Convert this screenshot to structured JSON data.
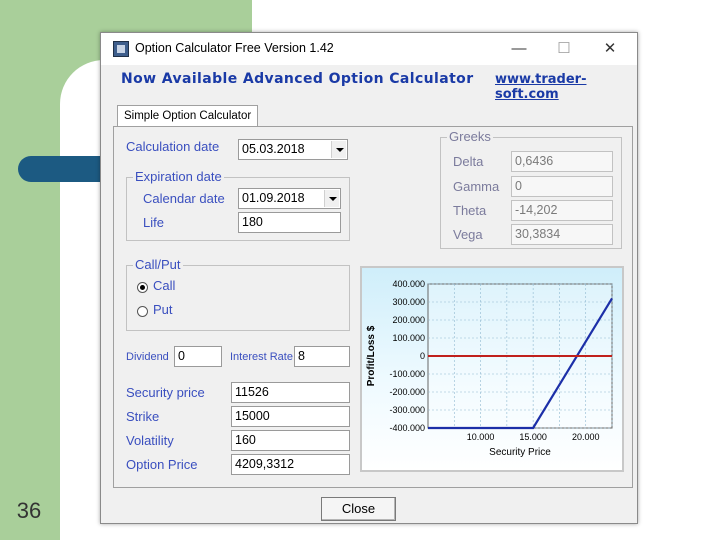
{
  "slide": {
    "page_number": "36"
  },
  "window": {
    "title": "Option Calculator  Free Version 1.42",
    "minimize_glyph": "—",
    "maximize_glyph": "☐",
    "close_glyph": "✕"
  },
  "banner": {
    "text": "Now Available Advanced Option Calculator",
    "link": "www.trader-soft.com"
  },
  "tab": {
    "label": "Simple Option Calculator"
  },
  "calc": {
    "calculation_date_label": "Calculation date",
    "calculation_date_value": "05.03.2018",
    "expiration_group": "Expiration date",
    "calendar_date_label": "Calendar date",
    "calendar_date_value": "01.09.2018",
    "life_label": "Life",
    "life_value": "180",
    "callput_group": "Call/Put",
    "call_label": "Call",
    "put_label": "Put",
    "selected": "Call",
    "dividend_label": "Dividend",
    "dividend_value": "0",
    "interest_label": "Interest Rate",
    "interest_value": "8",
    "security_price_label": "Security price",
    "security_price_value": "11526",
    "strike_label": "Strike",
    "strike_value": "15000",
    "volatility_label": "Volatility",
    "volatility_value": "160",
    "option_price_label": "Option Price",
    "option_price_value": "4209,3312"
  },
  "greeks": {
    "group": "Greeks",
    "delta_label": "Delta",
    "delta_value": "0,6436",
    "gamma_label": "Gamma",
    "gamma_value": "0",
    "theta_label": "Theta",
    "theta_value": "-14,202",
    "vega_label": "Vega",
    "vega_value": "30,3834"
  },
  "footer": {
    "close_label": "Close"
  },
  "chart_data": {
    "type": "line",
    "xlabel": "Security Price",
    "ylabel": "Profit/Loss $",
    "ylim": [
      -400,
      400
    ],
    "xlim": [
      5000,
      22500
    ],
    "xtick_values": [
      10000,
      15000,
      20000
    ],
    "xtick_labels": [
      "10.000",
      "15.000",
      "20.000"
    ],
    "ytick_values": [
      400,
      300,
      200,
      100,
      0,
      -100,
      -200,
      -300,
      -400
    ],
    "ytick_labels": [
      "400.000",
      "300.000",
      "200.000",
      "100.000",
      "0",
      "-100.000",
      "-200.000",
      "-300.000",
      "-400.000"
    ],
    "grid": true,
    "series": [
      {
        "color": "#1c2fa8",
        "x": [
          5000,
          15000,
          22500
        ],
        "y": [
          -400,
          -400,
          320
        ]
      },
      {
        "color": "#c0201c",
        "x": [
          5000,
          22500
        ],
        "y": [
          0,
          0
        ]
      }
    ]
  }
}
